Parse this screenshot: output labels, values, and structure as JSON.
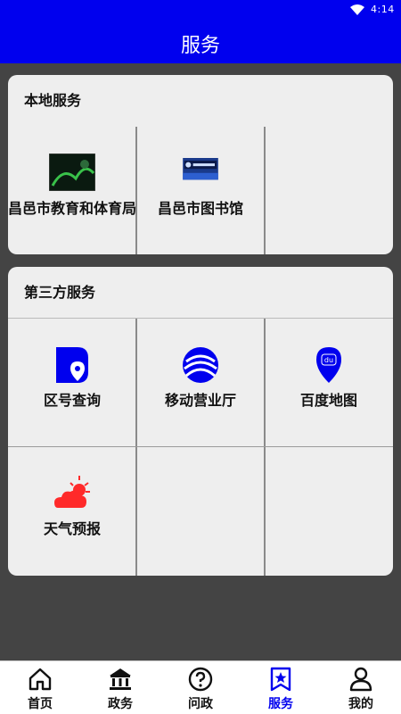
{
  "status_bar": {
    "time": "4:14",
    "icons": [
      "wifi-icon"
    ]
  },
  "app_bar": {
    "title": "服务"
  },
  "local_services": {
    "header": "本地服务",
    "items": [
      {
        "label": "昌邑市教育和体育局",
        "image": "education-bureau-thumbnail"
      },
      {
        "label": "昌邑市图书馆",
        "image": "library-thumbnail"
      }
    ]
  },
  "third_party_services": {
    "header": "第三方服务",
    "items": [
      {
        "label": "区号查询",
        "icon": "area-code-icon"
      },
      {
        "label": "移动营业厅",
        "icon": "china-mobile-icon"
      },
      {
        "label": "百度地图",
        "icon": "baidu-map-pin-icon"
      },
      {
        "label": "天气预报",
        "icon": "weather-icon"
      }
    ]
  },
  "tabs": [
    {
      "label": "首页",
      "icon": "home-icon",
      "active": false
    },
    {
      "label": "政务",
      "icon": "government-building-icon",
      "active": false
    },
    {
      "label": "问政",
      "icon": "question-icon",
      "active": false
    },
    {
      "label": "服务",
      "icon": "service-star-icon",
      "active": true
    },
    {
      "label": "我的",
      "icon": "person-icon",
      "active": false
    }
  ],
  "colors": {
    "primary": "#0000ee",
    "background": "#444444",
    "card": "#eeeeee",
    "weather_red": "#ff2a2a"
  }
}
